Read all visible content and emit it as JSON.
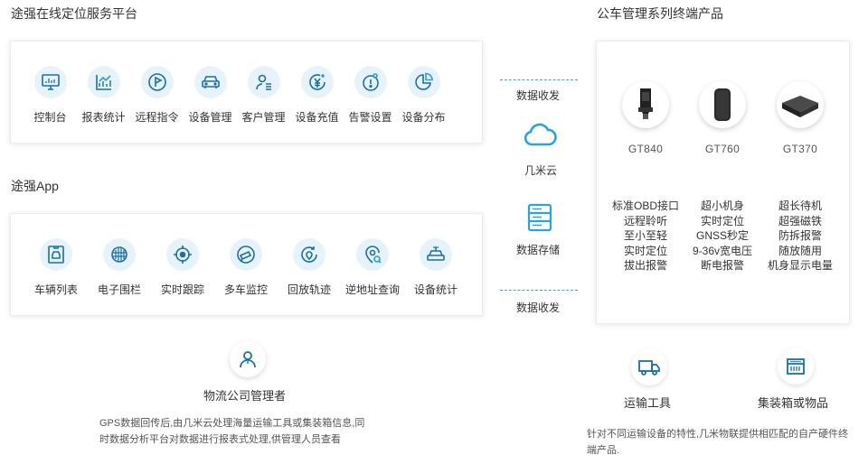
{
  "platform": {
    "title": "途强在线定位服务平台",
    "items": [
      {
        "label": "控制台",
        "icon": "monitor-icon"
      },
      {
        "label": "报表统计",
        "icon": "chart-icon"
      },
      {
        "label": "远程指令",
        "icon": "flag-icon"
      },
      {
        "label": "设备管理",
        "icon": "car-icon"
      },
      {
        "label": "客户管理",
        "icon": "user-list-icon"
      },
      {
        "label": "设备充值",
        "icon": "yuan-icon"
      },
      {
        "label": "告警设置",
        "icon": "alarm-icon"
      },
      {
        "label": "设备分布",
        "icon": "pie-icon"
      }
    ]
  },
  "app": {
    "title": "途强App",
    "items": [
      {
        "label": "车辆列表",
        "icon": "vehicle-list-icon"
      },
      {
        "label": "电子围栏",
        "icon": "fence-icon"
      },
      {
        "label": "实时跟踪",
        "icon": "target-icon"
      },
      {
        "label": "多车监控",
        "icon": "camera-icon"
      },
      {
        "label": "回放轨迹",
        "icon": "playback-icon"
      },
      {
        "label": "逆地址查询",
        "icon": "location-search-icon"
      },
      {
        "label": "设备统计",
        "icon": "device-stats-icon"
      }
    ]
  },
  "middle": {
    "receive_top": "数据收发",
    "cloud": "几米云",
    "storage": "数据存储",
    "receive_bottom": "数据收发"
  },
  "products": {
    "title": "公车管理系列终端产品",
    "items": [
      {
        "name": "GT840",
        "features": [
          "标准OBD接口",
          "远程聆听",
          "至小至轻",
          "实时定位",
          "拔出报警"
        ]
      },
      {
        "name": "GT760",
        "features": [
          "超小机身",
          "实时定位",
          "GNSS秒定",
          "9-36v宽电压",
          "断电报警"
        ]
      },
      {
        "name": "GT370",
        "features": [
          "超长待机",
          "超强磁铁",
          "防拆报警",
          "随放随用",
          "机身显示电量"
        ]
      }
    ]
  },
  "manager": {
    "label": "物流公司管理者",
    "description": "GPS数据回传后,由几米云处理海量运输工具或集装箱信息,同时数据分析平台对数据进行报表式处理,供管理人员查看"
  },
  "transport": {
    "tools_label": "运输工具",
    "container_label": "集装箱或物品",
    "description": "针对不同运输设备的特性,几米物联提供相匹配的自产硬件终端产品."
  },
  "colors": {
    "accent": "#1a8fd3",
    "icon_bg": "#e6f3fb",
    "dash": "#3aa6dd"
  }
}
